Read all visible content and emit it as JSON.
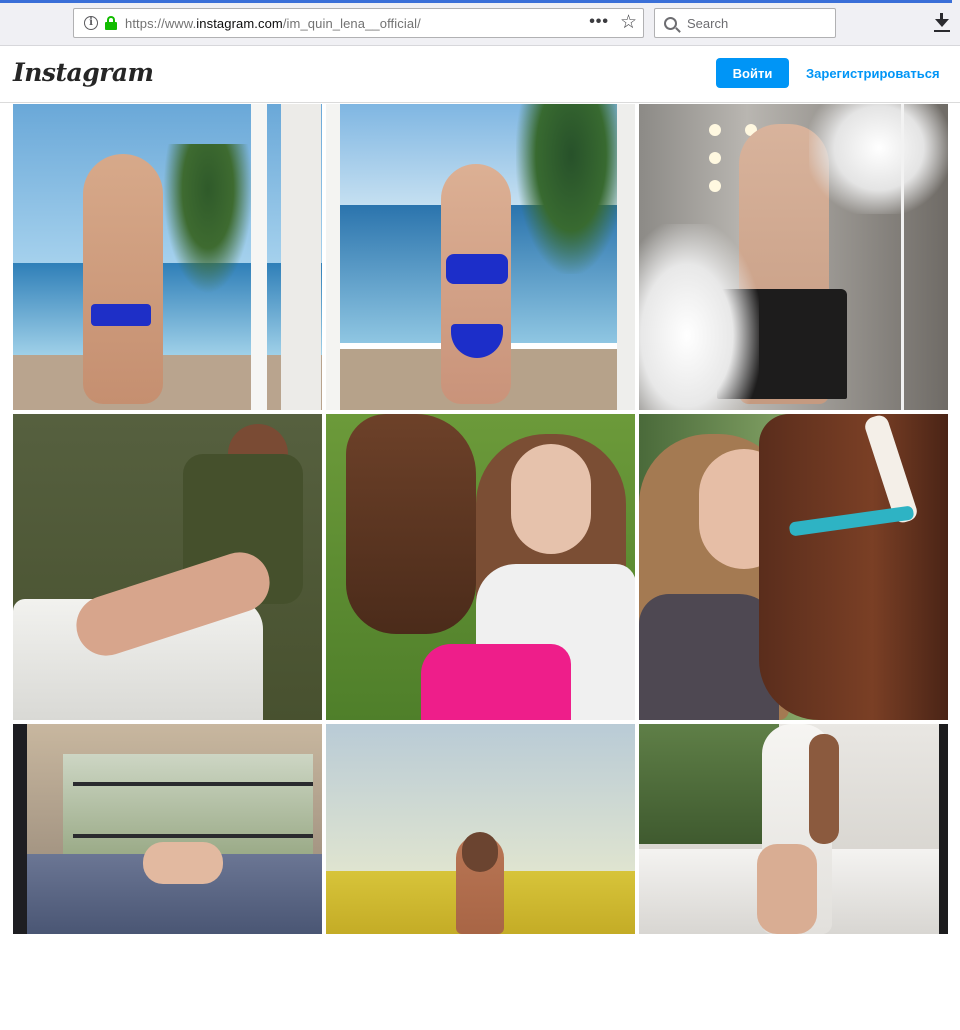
{
  "browser": {
    "url_prefix": "https://www.",
    "url_host": "instagram.com",
    "url_path": "/im_quin_lena__official/",
    "search_placeholder": "Search",
    "page_actions_label": "•••",
    "bookmark_glyph": "☆",
    "info_glyph": "i"
  },
  "header": {
    "logo": "Instagram",
    "login_label": "Войти",
    "signup_label": "Зарегистрироваться"
  },
  "colors": {
    "accent": "#0095f6",
    "lock": "#12bc00"
  },
  "icons": [
    "info-icon",
    "lock-icon",
    "star-icon",
    "search-icon",
    "download-icon"
  ],
  "posts_count_visible": 9
}
